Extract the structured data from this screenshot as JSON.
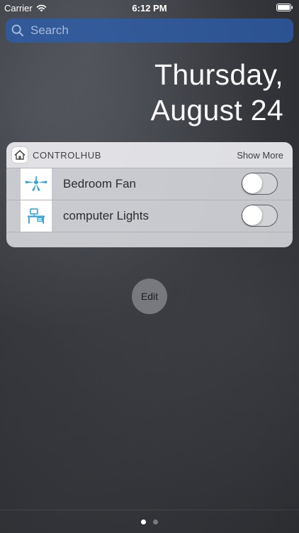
{
  "status_bar": {
    "carrier": "Carrier",
    "time": "6:12 PM",
    "icons": [
      "wifi-icon",
      "battery-icon"
    ]
  },
  "search": {
    "placeholder": "Search",
    "value": "",
    "icon": "search-icon"
  },
  "date": {
    "weekday": "Thursday,",
    "day": "August 24"
  },
  "widget": {
    "app_icon": "house-icon",
    "title": "CONTROLHUB",
    "show_more_label": "Show More",
    "devices": [
      {
        "label": "Bedroom Fan",
        "icon": "ceiling-fan-icon",
        "on": false
      },
      {
        "label": "computer Lights",
        "icon": "desk-lamp-icon",
        "on": false
      }
    ]
  },
  "edit_label": "Edit",
  "page_indicator": {
    "current": 1,
    "total": 2
  },
  "colors": {
    "search_bg": "#2c5cac",
    "accent_blue": "#2fa3d8",
    "widget_bg": "#dee0e4"
  }
}
